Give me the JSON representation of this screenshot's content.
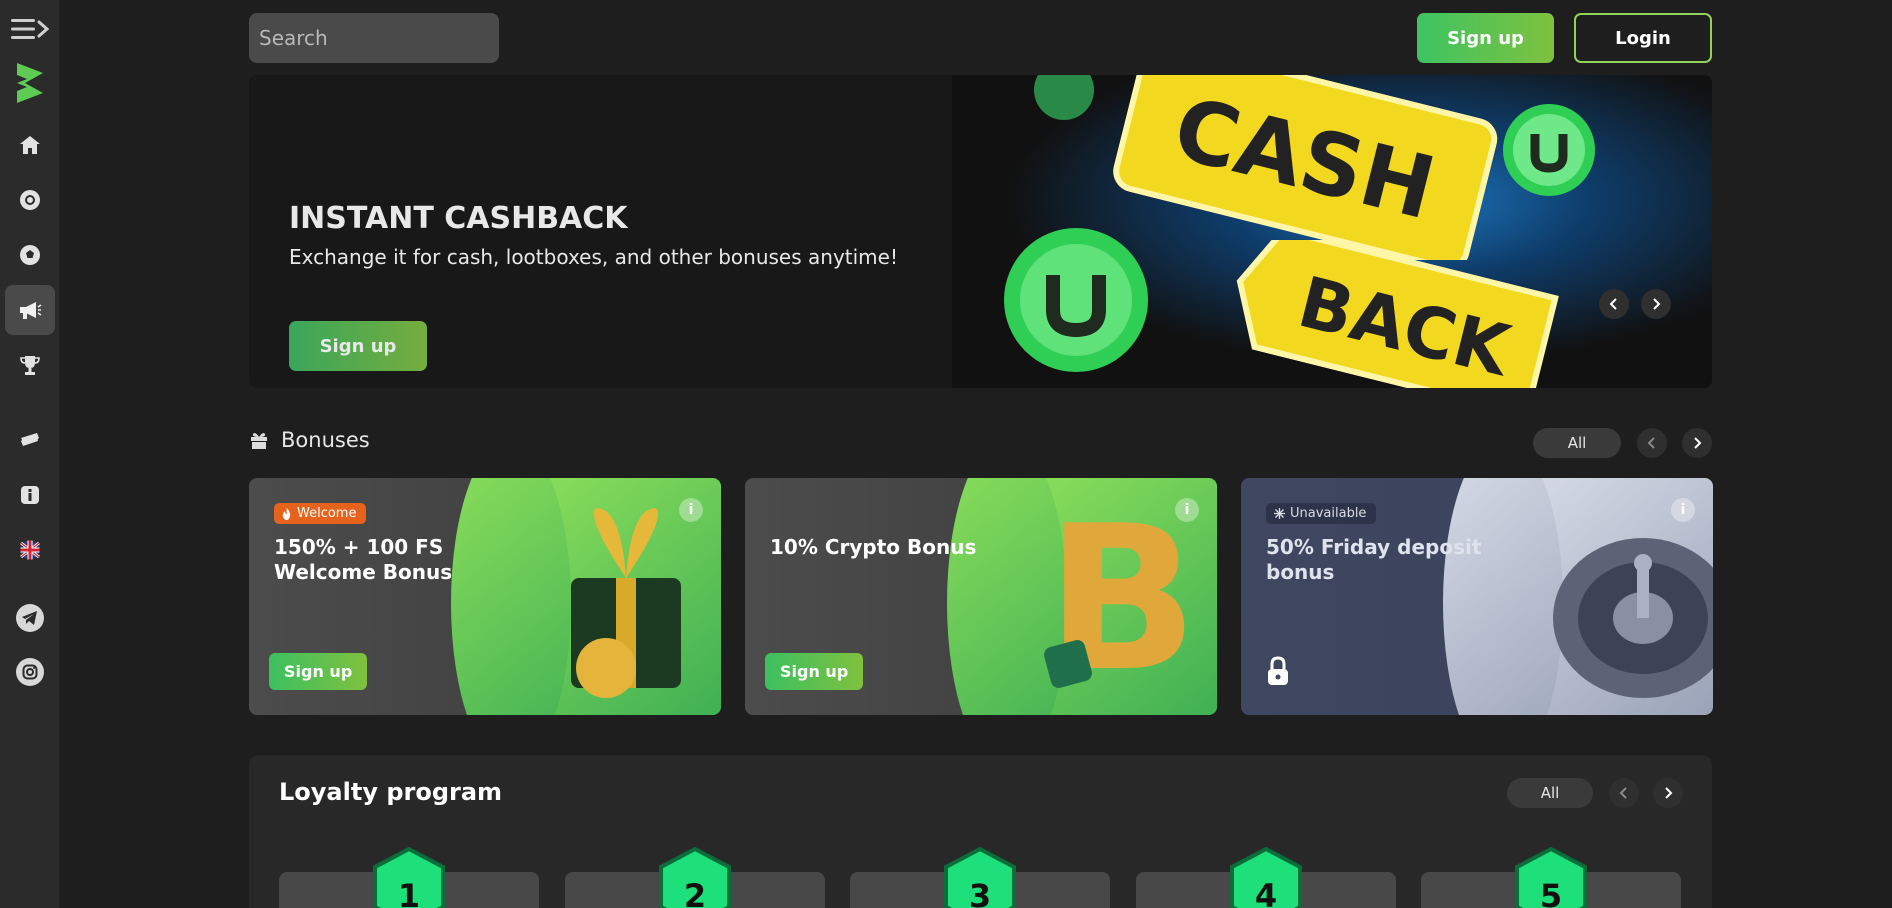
{
  "sidebar": {
    "items": [
      {
        "name": "menu-toggle",
        "icon": "menu-arrow-icon"
      },
      {
        "name": "logo",
        "icon": "brand-logo-icon"
      },
      {
        "name": "home",
        "icon": "home-icon"
      },
      {
        "name": "casino",
        "icon": "casino-chip-icon"
      },
      {
        "name": "sports",
        "icon": "soccer-ball-icon"
      },
      {
        "name": "promotions",
        "icon": "megaphone-icon",
        "active": true
      },
      {
        "name": "tournaments",
        "icon": "trophy-icon"
      },
      {
        "name": "vip",
        "icon": "ticket-icon"
      },
      {
        "name": "info",
        "icon": "info-icon"
      },
      {
        "name": "language",
        "icon": "uk-flag-icon"
      },
      {
        "name": "telegram",
        "icon": "telegram-icon"
      },
      {
        "name": "instagram",
        "icon": "instagram-icon"
      }
    ]
  },
  "header": {
    "search_placeholder": "Search",
    "signup_label": "Sign up",
    "login_label": "Login"
  },
  "banner": {
    "title": "INSTANT CASHBACK",
    "subtitle": "Exchange it for cash, lootboxes, and other bonuses anytime!",
    "button_label": "Sign up",
    "art_text_1": "CASH",
    "art_text_2": "BACK"
  },
  "bonuses": {
    "heading": "Bonuses",
    "all_label": "All",
    "cards": [
      {
        "badge": "Welcome",
        "title": "150% + 100 FS Welcome Bonus",
        "button": "Sign up"
      },
      {
        "title": "10% Crypto Bonus",
        "button": "Sign up"
      },
      {
        "badge": "Unavailable",
        "title": "50% Friday deposit bonus",
        "locked": true
      }
    ]
  },
  "loyalty": {
    "heading": "Loyalty program",
    "all_label": "All",
    "levels": [
      "1",
      "2",
      "3",
      "4",
      "5"
    ]
  },
  "colors": {
    "accent_green": "#3dc463",
    "accent_lime": "#7fc13e",
    "badge_orange": "#e5631d",
    "page_bg": "#1e1e1e"
  }
}
